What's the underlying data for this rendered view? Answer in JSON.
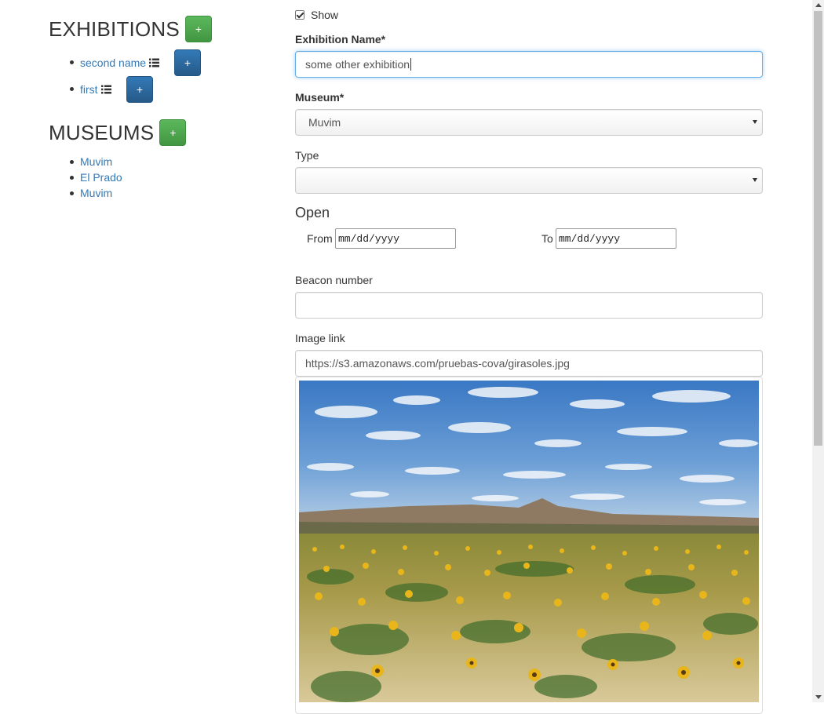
{
  "sidebar": {
    "exhibitions_title": "EXHIBITIONS",
    "add_exhibition_label": "+",
    "exhibitions": [
      {
        "name": "second name",
        "icon": "list-icon",
        "action_label": "+"
      },
      {
        "name": "first",
        "icon": "list-icon",
        "action_label": "+"
      }
    ],
    "museums_title": "MUSEUMS",
    "add_museum_label": "+",
    "museums": [
      "Muvim",
      "El Prado",
      "Muvim"
    ]
  },
  "form": {
    "show_label": "Show",
    "show_checked": true,
    "name_label": "Exhibition Name*",
    "name_value": "some other exhibition",
    "museum_label": "Museum*",
    "museum_value": "Muvim",
    "type_label": "Type",
    "type_value": "",
    "open_title": "Open",
    "from_label": "From",
    "from_placeholder": "mm/dd/yyyy",
    "to_label": "To",
    "to_placeholder": "mm/dd/yyyy",
    "beacon_label": "Beacon number",
    "beacon_value": "",
    "image_label": "Image link",
    "image_value": "https://s3.amazonaws.com/pruebas-cova/girasoles.jpg",
    "image_subject": "sunflower field landscape"
  },
  "colors": {
    "success": "#5cb85c",
    "primary": "#337ab7",
    "link": "#337ab7",
    "focus_border": "#66afe9"
  }
}
